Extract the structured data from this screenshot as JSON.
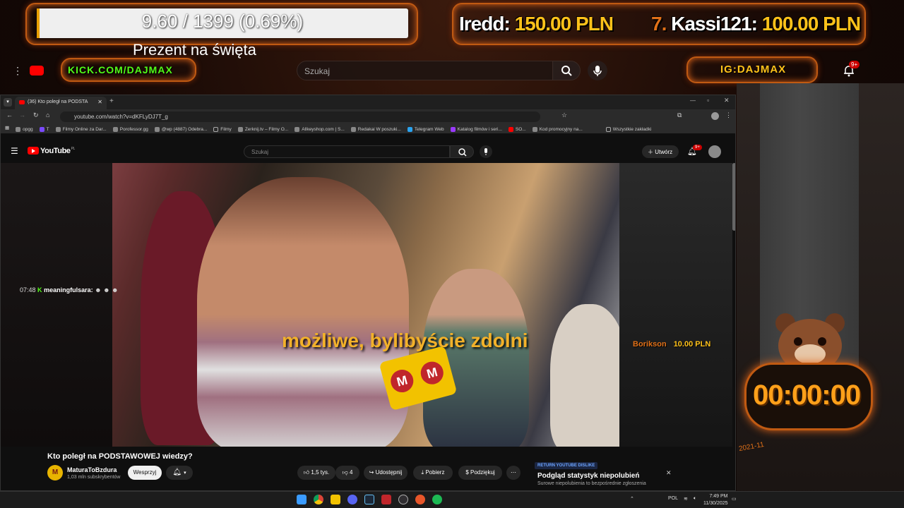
{
  "overlay": {
    "goal_text": "9.60 / 1399 (0.69%)",
    "goal_progress": 0.0069,
    "goal_caption": "Prezent na święta",
    "donations_top": [
      {
        "name": "Iredd:",
        "amount": "150.00 PLN"
      },
      {
        "rank": "7.",
        "name": "Kassi121:",
        "amount": "100.00 PLN"
      }
    ],
    "kick_link": "KICK.COM/DAJMAX",
    "ig_handle": "IG:DAJMAX",
    "outer_search_placeholder": "Szukaj",
    "outer_notifications": "9+",
    "timer": "00:00:00",
    "chat_time": "07:48",
    "chat_user": "meaningfulsara:",
    "donation_alert": {
      "name": "Borikson",
      "amount": "10.00 PLN"
    },
    "date_badge": "2021-11"
  },
  "browser": {
    "tab_title": "(36) Kto poległ na PODSTA",
    "url": "youtube.com/watch?v=dKFLyDJ7T_g",
    "bookmarks": [
      "opgg",
      "T",
      "Filmy Online za Dar...",
      "Porofessor.gg",
      "@wp (4887) Odebra...",
      "Filmy",
      "Zerknij.tv – Filmy O...",
      "Allkeyshop.com | S...",
      "Redakai W poszuki...",
      "Telegram Web",
      "Katalog filmów i seri...",
      "SO...",
      "Kod promocyjny na..."
    ],
    "all_bookmarks": "Wszystkie zakładki"
  },
  "youtube": {
    "logo": "YouTube",
    "logo_region": "PL",
    "search_placeholder": "Szukaj",
    "create_label": "Utwórz",
    "notifications": "9+",
    "subtitle": "możliwe, bylibyście zdolni",
    "mic_letter": "M",
    "video_title": "Kto poległ na PODSTAWOWEJ wiedzy?",
    "channel_name": "MaturaToBzdura",
    "channel_subs": "1,03 mln subskrybentów",
    "support_label": "Wesprzyj",
    "likes": "1,5 tys.",
    "dislikes": "4",
    "share_label": "Udostępnij",
    "download_label": "Pobierz",
    "thanks_label": "Podziękuj",
    "ryd_tag": "RETURN YOUTUBE DISLIKE",
    "ryd_title": "Podgląd statystyk niepolubień",
    "ryd_sub": "Surowe niepolubienia to bezpośrednie zgłoszenia"
  },
  "taskbar": {
    "lang": "POL",
    "time": "7:49 PM",
    "date": "11/30/2025"
  }
}
